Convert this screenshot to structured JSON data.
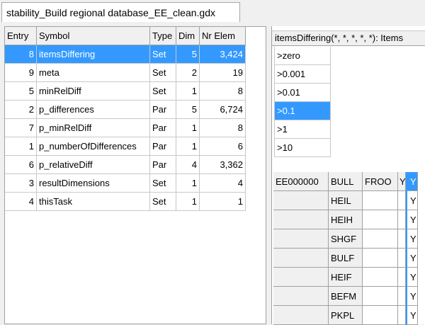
{
  "tab": {
    "title": "stability_Build regional database_EE_clean.gdx"
  },
  "symbol_table": {
    "headers": {
      "entry": "Entry",
      "symbol": "Symbol",
      "type": "Type",
      "dim": "Dim",
      "nr_elem": "Nr Elem"
    },
    "rows": [
      {
        "entry": "8",
        "symbol": "itemsDiffering",
        "type": "Set",
        "dim": "5",
        "nr_elem": "3,424",
        "selected": true
      },
      {
        "entry": "9",
        "symbol": "meta",
        "type": "Set",
        "dim": "2",
        "nr_elem": "19"
      },
      {
        "entry": "5",
        "symbol": "minRelDiff",
        "type": "Set",
        "dim": "1",
        "nr_elem": "8"
      },
      {
        "entry": "2",
        "symbol": "p_differences",
        "type": "Par",
        "dim": "5",
        "nr_elem": "6,724"
      },
      {
        "entry": "7",
        "symbol": "p_minRelDiff",
        "type": "Par",
        "dim": "1",
        "nr_elem": "8"
      },
      {
        "entry": "1",
        "symbol": "p_numberOfDifferences",
        "type": "Par",
        "dim": "1",
        "nr_elem": "6"
      },
      {
        "entry": "6",
        "symbol": "p_relativeDiff",
        "type": "Par",
        "dim": "4",
        "nr_elem": "3,362"
      },
      {
        "entry": "3",
        "symbol": "resultDimensions",
        "type": "Set",
        "dim": "1",
        "nr_elem": "4"
      },
      {
        "entry": "4",
        "symbol": "thisTask",
        "type": "Set",
        "dim": "1",
        "nr_elem": "1"
      }
    ]
  },
  "detail": {
    "title": "itemsDiffering(*, *, *, *, *): Items",
    "filters": [
      {
        "label": ">zero"
      },
      {
        "label": ">0.001"
      },
      {
        "label": ">0.01"
      },
      {
        "label": ">0.1",
        "selected": true
      },
      {
        "label": ">1"
      },
      {
        "label": ">10"
      }
    ],
    "grid": {
      "header": [
        "EE000000",
        "BULL",
        "FROO",
        "Y",
        "Y"
      ],
      "rows": [
        [
          "",
          "HEIL",
          "",
          "",
          "Y"
        ],
        [
          "",
          "HEIH",
          "",
          "",
          "Y"
        ],
        [
          "",
          "SHGF",
          "",
          "",
          "Y"
        ],
        [
          "",
          "BULF",
          "",
          "",
          "Y"
        ],
        [
          "",
          "HEIF",
          "",
          "",
          "Y"
        ],
        [
          "",
          "BEFM",
          "",
          "",
          "Y"
        ],
        [
          "",
          "PKPL",
          "",
          "",
          "Y"
        ]
      ]
    }
  },
  "colors": {
    "selection": "#3399ff",
    "background": "#f0f0f0"
  }
}
